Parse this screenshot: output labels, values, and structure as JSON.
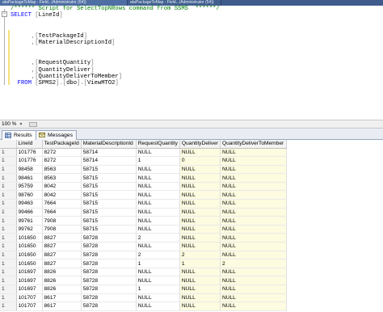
{
  "window_tabs": [
    "ataPackageToMap - Field.../Administrator (64))",
    "ataPackageToMap - Field.../Administrator (54))"
  ],
  "editor": {
    "lines": [
      {
        "parts": [
          {
            "cls": "c",
            "text": "/****** Script for SelectTopNRows command from SSMS  ******/"
          }
        ]
      },
      {
        "parts": [
          {
            "cls": "k",
            "text": "SELECT "
          },
          {
            "cls": "g",
            "text": "["
          },
          {
            "cls": "i",
            "text": "LineId"
          },
          {
            "cls": "g",
            "text": "]"
          }
        ]
      },
      {
        "parts": []
      },
      {
        "parts": []
      },
      {
        "parts": [
          {
            "cls": "i",
            "text": "      "
          },
          {
            "cls": "g",
            "text": ",["
          },
          {
            "cls": "i",
            "text": "TestPackageId"
          },
          {
            "cls": "g",
            "text": "]"
          }
        ]
      },
      {
        "parts": [
          {
            "cls": "i",
            "text": "      "
          },
          {
            "cls": "g",
            "text": ",["
          },
          {
            "cls": "i",
            "text": "MaterialDescriptionId"
          },
          {
            "cls": "g",
            "text": "]"
          }
        ]
      },
      {
        "parts": []
      },
      {
        "parts": []
      },
      {
        "parts": [
          {
            "cls": "i",
            "text": "      "
          },
          {
            "cls": "g",
            "text": ",["
          },
          {
            "cls": "i",
            "text": "RequestQuantity"
          },
          {
            "cls": "g",
            "text": "]"
          }
        ]
      },
      {
        "parts": [
          {
            "cls": "i",
            "text": "      "
          },
          {
            "cls": "g",
            "text": ",["
          },
          {
            "cls": "i",
            "text": "QuantityDeliver"
          },
          {
            "cls": "g",
            "text": "]"
          }
        ]
      },
      {
        "parts": [
          {
            "cls": "i",
            "text": "      "
          },
          {
            "cls": "g",
            "text": ",["
          },
          {
            "cls": "i",
            "text": "QuantityDeliverToMember"
          },
          {
            "cls": "g",
            "text": "]"
          }
        ]
      },
      {
        "parts": [
          {
            "cls": "i",
            "text": "  "
          },
          {
            "cls": "k",
            "text": "FROM "
          },
          {
            "cls": "g",
            "text": "["
          },
          {
            "cls": "i",
            "text": "SPMS2"
          },
          {
            "cls": "g",
            "text": "].["
          },
          {
            "cls": "i",
            "text": "dbo"
          },
          {
            "cls": "g",
            "text": "].["
          },
          {
            "cls": "i",
            "text": "ViewMTO2"
          },
          {
            "cls": "g",
            "text": "]"
          }
        ]
      }
    ]
  },
  "zoom": "100 %",
  "results_tabs": {
    "results": "Results",
    "messages": "Messages"
  },
  "grid": {
    "columns": [
      "",
      "LineId",
      "TestPackageId",
      "MaterialDescriptionId",
      "RequestQuantity",
      "QuantityDeliver",
      "QuantityDeliverToMember"
    ],
    "rows": [
      [
        "1",
        "101776",
        "8272",
        "58714",
        "NULL",
        "NULL",
        "NULL"
      ],
      [
        "1",
        "101776",
        "8272",
        "58714",
        "1",
        "0",
        "NULL"
      ],
      [
        "1",
        "98458",
        "8563",
        "58715",
        "NULL",
        "NULL",
        "NULL"
      ],
      [
        "1",
        "98461",
        "8563",
        "58715",
        "NULL",
        "NULL",
        "NULL"
      ],
      [
        "1",
        "95759",
        "8042",
        "58715",
        "NULL",
        "NULL",
        "NULL"
      ],
      [
        "1",
        "98760",
        "8042",
        "58715",
        "NULL",
        "NULL",
        "NULL"
      ],
      [
        "1",
        "99463",
        "7664",
        "58715",
        "NULL",
        "NULL",
        "NULL"
      ],
      [
        "1",
        "99466",
        "7664",
        "58715",
        "NULL",
        "NULL",
        "NULL"
      ],
      [
        "1",
        "99761",
        "7908",
        "58715",
        "NULL",
        "NULL",
        "NULL"
      ],
      [
        "1",
        "99762",
        "7908",
        "58715",
        "NULL",
        "NULL",
        "NULL"
      ],
      [
        "1",
        "101650",
        "8827",
        "58728",
        "2",
        "NULL",
        "NULL"
      ],
      [
        "1",
        "101650",
        "8827",
        "58728",
        "NULL",
        "NULL",
        "NULL"
      ],
      [
        "1",
        "101650",
        "8827",
        "58728",
        "2",
        "2",
        "NULL"
      ],
      [
        "1",
        "101650",
        "8827",
        "58728",
        "1",
        "1",
        "2"
      ],
      [
        "1",
        "101697",
        "8826",
        "58728",
        "NULL",
        "NULL",
        "NULL"
      ],
      [
        "1",
        "101697",
        "8826",
        "58728",
        "NULL",
        "NULL",
        "NULL"
      ],
      [
        "1",
        "101697",
        "8826",
        "58728",
        "1",
        "NULL",
        "NULL"
      ],
      [
        "1",
        "101707",
        "8617",
        "58728",
        "NULL",
        "NULL",
        "NULL"
      ],
      [
        "1",
        "101707",
        "8617",
        "58728",
        "NULL",
        "NULL",
        "NULL"
      ]
    ]
  }
}
